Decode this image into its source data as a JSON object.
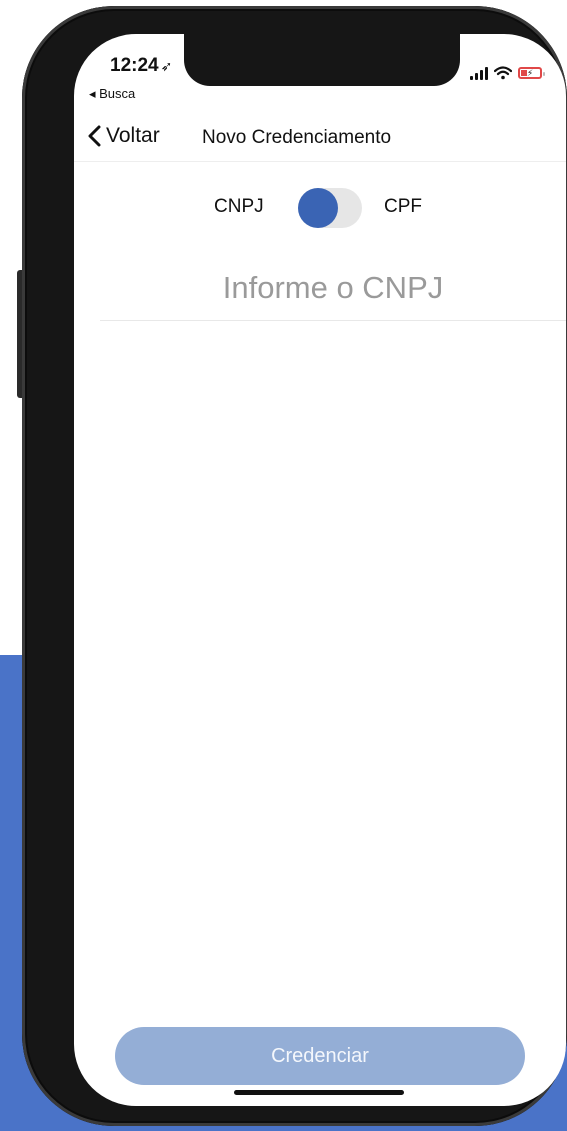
{
  "status_bar": {
    "time": "12:24",
    "location_icon": "location-arrow-icon",
    "back_app": "◂ Busca",
    "signal_icon": "signal-icon",
    "wifi_icon": "wifi-icon",
    "battery_icon": "battery-charging-icon",
    "battery_color": "#e04848"
  },
  "nav": {
    "back_label": "Voltar",
    "title": "Novo Credenciamento"
  },
  "toggle": {
    "left_label": "CNPJ",
    "right_label": "CPF",
    "selected": "CNPJ",
    "accent_color": "#3a64b4"
  },
  "form": {
    "cnpj_placeholder": "Informe o CNPJ",
    "cnpj_value": ""
  },
  "actions": {
    "submit_label": "Credenciar",
    "submit_color": "#94aed6"
  },
  "background_accent": "#4a73c8"
}
